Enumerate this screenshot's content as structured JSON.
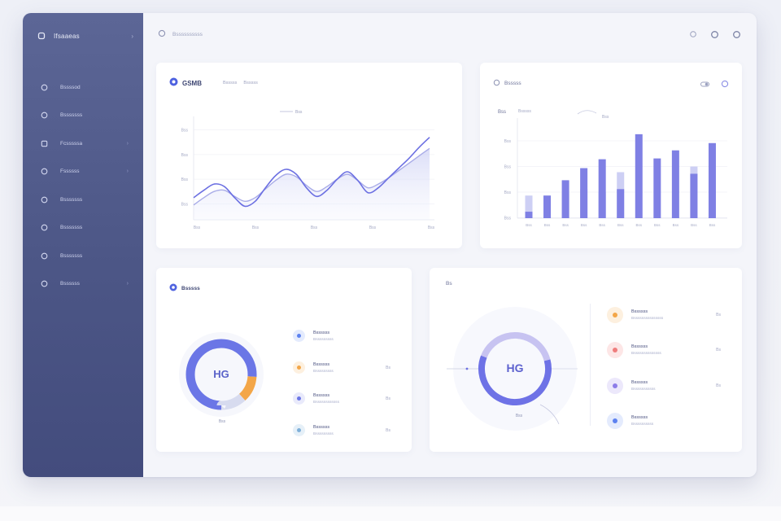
{
  "colors": {
    "sidebar_top": "#5c6696",
    "sidebar_bottom": "#434c7d",
    "accent": "#6b6fe0",
    "accent_light": "#c3c5f3",
    "orange": "#f3a648",
    "red": "#ef7d7d",
    "blue": "#5d82f0"
  },
  "sidebar": {
    "brand_label": "Ifsaaeas",
    "items": [
      {
        "label": "Bssssod",
        "icon": "circle-icon"
      },
      {
        "label": "Bsssssss",
        "icon": "circle-icon"
      },
      {
        "label": "Fcsssssa",
        "icon": "square-icon"
      },
      {
        "label": "Fssssss",
        "icon": "circle-icon"
      },
      {
        "label": "Bsssssss",
        "icon": "circle-icon"
      },
      {
        "label": "Bsssssss",
        "icon": "circle-icon"
      },
      {
        "label": "Bsssssss",
        "icon": "circle-icon"
      },
      {
        "label": "Bssssss",
        "icon": "circle-icon"
      }
    ]
  },
  "topbar": {
    "crumb": "Bssssssssss"
  },
  "line_card": {
    "title": "GSMB",
    "tabs": [
      "Bsssss",
      "Bsssss"
    ],
    "chart_data": {
      "type": "line",
      "x": [
        "Bss",
        "Bss",
        "Bss",
        "Bss",
        "Bss"
      ],
      "yticks": [
        "Bss",
        "Bss",
        "Bss",
        "Bss"
      ],
      "legend": "Bss",
      "series": [
        {
          "values": [
            18,
            24,
            29,
            27,
            18,
            11,
            15,
            26,
            36,
            41,
            37,
            26,
            19,
            24,
            33,
            39,
            32,
            22,
            26,
            34,
            42,
            50,
            59,
            67
          ]
        },
        {
          "values": [
            12,
            18,
            23,
            24,
            19,
            15,
            18,
            25,
            32,
            37,
            35,
            28,
            23,
            27,
            33,
            37,
            32,
            26,
            29,
            34,
            40,
            46,
            52,
            58
          ]
        }
      ],
      "ylim": [
        0,
        80
      ]
    }
  },
  "bar_card": {
    "title": "Bsssss",
    "chart_data": {
      "type": "bar",
      "categories": [
        "Bss",
        "Bss",
        "Bss",
        "Bss",
        "Bss",
        "Bss",
        "Bss",
        "Bss",
        "Bss",
        "Bss",
        "Bss"
      ],
      "yticks": [
        "Bss",
        "Bss",
        "Bss",
        "Bss"
      ],
      "axis_tag": "Bss",
      "legend": [
        "Bsssss",
        "Bss"
      ],
      "series": [
        {
          "values": [
            8,
            28,
            47,
            62,
            73,
            36,
            104,
            74,
            84,
            55,
            93
          ]
        },
        {
          "values": [
            28,
            28,
            31,
            36,
            32,
            57,
            0,
            0,
            0,
            64,
            0
          ]
        }
      ],
      "ylim": [
        0,
        120
      ]
    }
  },
  "donut_card_a": {
    "title": "Bsssss",
    "center": "HG",
    "caption": "Bss",
    "chart_data": {
      "type": "pie",
      "slices": [
        {
          "label": "Bssssss",
          "value": 76,
          "color": "#6b76e6"
        },
        {
          "label": "Bssssss",
          "value": 12,
          "color": "#f3a648"
        },
        {
          "label": "Bssssss",
          "value": 12,
          "color": "#d7dbef"
        }
      ]
    },
    "legend": [
      {
        "name": "Bssssss",
        "sub": "Bsssssssss",
        "val": "",
        "dot": "#5d82f0",
        "ring": "#e4ebfd"
      },
      {
        "name": "Bssssss",
        "sub": "Bsssssssss",
        "val": "Bs",
        "dot": "#f3a648",
        "ring": "#fdf0df"
      },
      {
        "name": "Bssssss",
        "sub": "Bssssssssssss",
        "val": "Bs",
        "dot": "#6b76e6",
        "ring": "#e9eafb"
      },
      {
        "name": "Bssssss",
        "sub": "Bsssssssss",
        "val": "Bs",
        "dot": "#7fb0d9",
        "ring": "#e6f0f8"
      }
    ]
  },
  "donut_card_b": {
    "title": "Bs",
    "center": "HG",
    "caption": "Bss",
    "chart_data": {
      "type": "pie",
      "slices": [
        {
          "label": "Bssssss",
          "value": 60,
          "color": "#6e72e6"
        },
        {
          "label": "Bssssss",
          "value": 40,
          "color": "#c7c3f1"
        }
      ]
    },
    "legend": [
      {
        "name": "Bssssss",
        "sub": "Bsssssssssssssss",
        "val": "Bs",
        "dot": "#f3a648",
        "ring": "#fdf0df"
      },
      {
        "name": "Bssssss",
        "sub": "Bssssssssssssss",
        "val": "Bs",
        "dot": "#ef7d7d",
        "ring": "#fde6e6"
      },
      {
        "name": "Bssssss",
        "sub": "Bsssssssssss",
        "val": "Bs",
        "dot": "#8d7de8",
        "ring": "#ece8fb"
      },
      {
        "name": "Bssssss",
        "sub": "Bssssssssss",
        "val": "",
        "dot": "#5d82f0",
        "ring": "#e4ebfd"
      }
    ]
  }
}
